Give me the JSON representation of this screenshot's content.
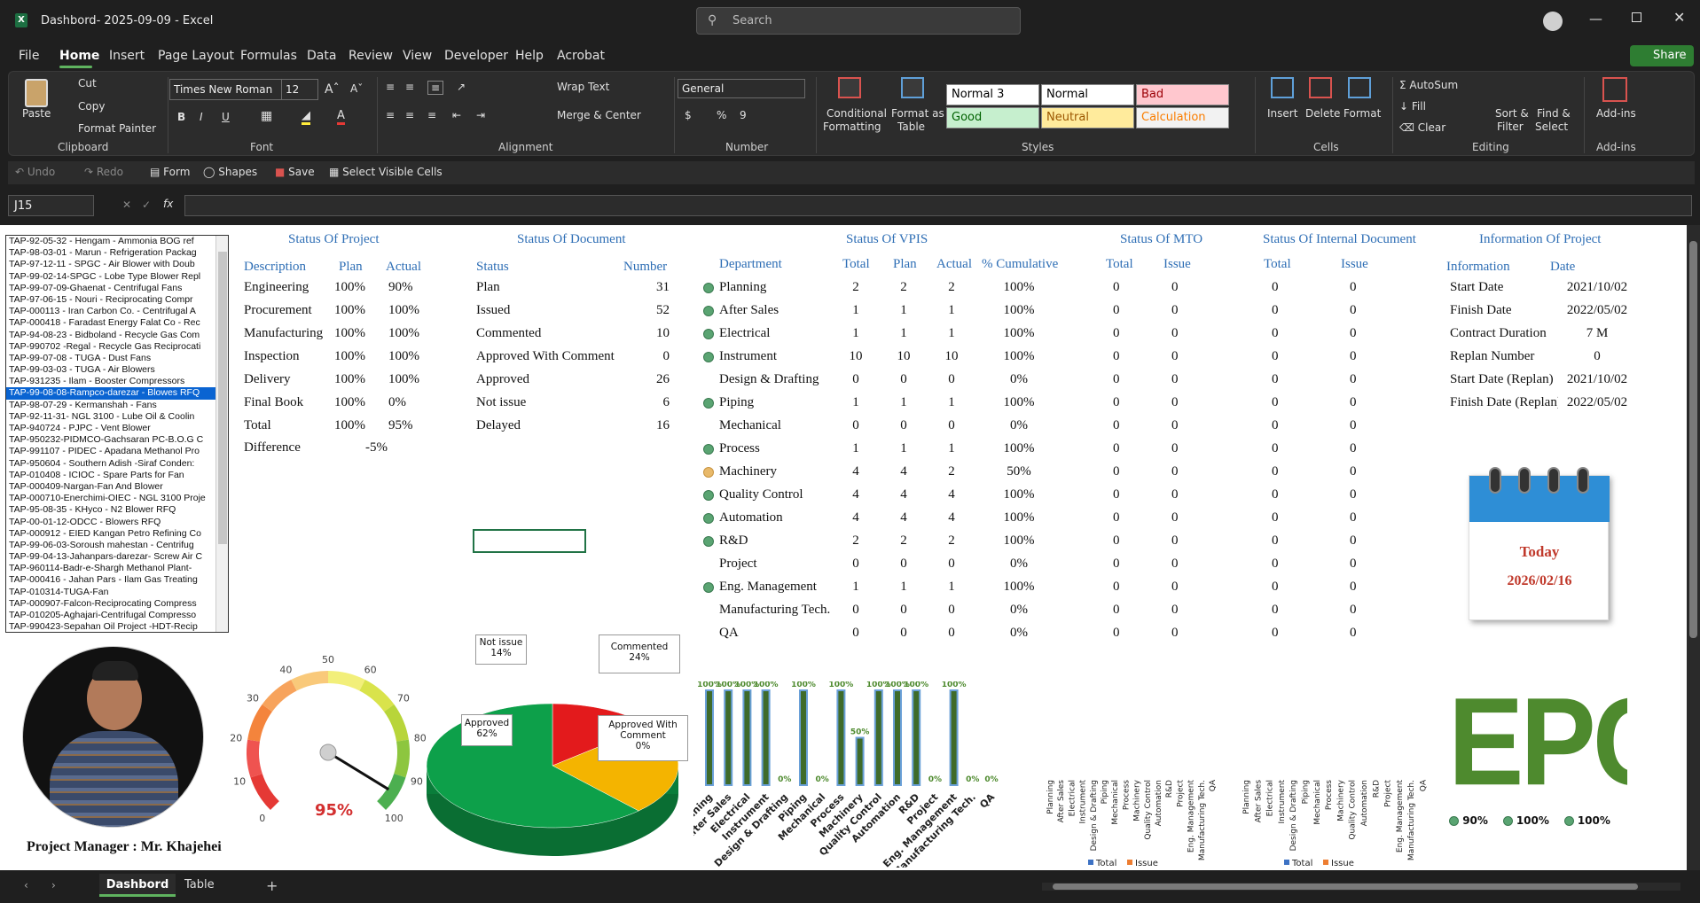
{
  "window": {
    "title": "Dashbord- 2025-09-09  -  Excel",
    "search_placeholder": "Search"
  },
  "menu": {
    "items": [
      "File",
      "Home",
      "Insert",
      "Page Layout",
      "Formulas",
      "Data",
      "Review",
      "View",
      "Developer",
      "Help",
      "Acrobat"
    ],
    "share": "Share"
  },
  "ribbon": {
    "clipboard": {
      "paste": "Paste",
      "cut": "Cut",
      "copy": "Copy",
      "format_painter": "Format Painter",
      "label": "Clipboard"
    },
    "font": {
      "family": "Times New Roman",
      "size": "12",
      "label": "Font"
    },
    "alignment": {
      "wrap": "Wrap Text",
      "merge": "Merge & Center",
      "label": "Alignment"
    },
    "number": {
      "format": "General",
      "label": "Number"
    },
    "styles": {
      "cond_fmt": "Conditional",
      "cond_fmt2": "Formatting",
      "format_table": "Format as",
      "format_table2": "Table",
      "normal3": "Normal 3",
      "normal": "Normal",
      "bad": "Bad",
      "good": "Good",
      "neutral": "Neutral",
      "calculation": "Calculation",
      "label": "Styles"
    },
    "cells": {
      "insert": "Insert",
      "delete": "Delete",
      "format": "Format",
      "label": "Cells"
    },
    "editing": {
      "autosum": "AutoSum",
      "fill": "Fill",
      "clear": "Clear",
      "sort": "Sort &",
      "sort2": "Filter",
      "find": "Find &",
      "find2": "Select",
      "label": "Editing"
    },
    "addins": {
      "label": "Add-ins",
      "btn": "Add-ins"
    }
  },
  "qat": {
    "undo": "Undo",
    "redo": "Redo",
    "form": "Form",
    "shapes": "Shapes",
    "save": "Save",
    "select_visible": "Select Visible Cells"
  },
  "formula_bar": {
    "name_box": "J15",
    "fx": "fx",
    "formula": ""
  },
  "projects": [
    "TAP-92-05-32 - Hengam - Ammonia BOG ref",
    "TAP-98-03-01 - Marun - Refrigeration Packag",
    "TAP-97-12-11 - SPGC - Air Blower with Doub",
    "TAP-99-02-14-SPGC - Lobe Type Blower Repl",
    "TAP-99-07-09-Ghaenat - Centrifugal Fans",
    "TAP-97-06-15 - Nouri - Reciprocating Compr",
    "TAP-000113 - Iran Carbon Co. - Centrifugal A",
    "TAP-000418 - Faradast Energy Falat Co - Rec",
    "TAP-94-08-23 - Bidboland - Recycle Gas Com",
    "TAP-990702 -Regal - Recycle Gas Reciprocati",
    "TAP-99-07-08  - TUGA - Dust Fans",
    "TAP-99-03-03 - TUGA - Air Blowers",
    "TAP-931235 - Ilam - Booster Compressors",
    "TAP-99-08-08-Rampco-darezar - Blowes RFQ",
    "TAP-98-07-29 - Kermanshah - Fans",
    "TAP-92-11-31- NGL 3100 - Lube Oil & Coolin",
    "TAP-940724 - PJPC - Vent Blower",
    "TAP-950232-PIDMCO-Gachsaran PC-B.O.G C",
    "TAP-991107 - PIDEC - Apadana Methanol Pro",
    "TAP-950604 - Southern Adish -Siraf Conden:",
    "TAP-010408 - ICIOC - Spare Parts for Fan",
    "TAP-000409-Nargan-Fan And Blower",
    "TAP-000710-Enerchimi-OIEC - NGL 3100 Proje",
    "TAP-95-08-35 - KHyco - N2 Blower RFQ",
    "TAP-00-01-12-ODCC - Blowers RFQ",
    "TAP-000912 - EIED Kangan Petro Refining Co",
    "TAP-99-06-03-Soroush mahestan - Centrifug",
    "TAP-99-04-13-Jahanpars-darezar- Screw Air C",
    "TAP-960114-Badr-e-Shargh Methanol Plant-",
    "TAP-000416 - Jahan Pars - Ilam Gas Treating",
    "TAP-010314-TUGA-Fan",
    "TAP-000907-Falcon-Reciprocating Compress",
    "TAP-010205-Aghajari-Centrifugal Compresso",
    "TAP-990423-Sepahan Oil Project -HDT-Recip"
  ],
  "status_project": {
    "title": "Status Of Project",
    "headers": [
      "Description",
      "Plan",
      "Actual"
    ],
    "rows": [
      [
        "Engineering",
        "100%",
        "90%"
      ],
      [
        "Procurement",
        "100%",
        "100%"
      ],
      [
        "Manufacturing",
        "100%",
        "100%"
      ],
      [
        "Inspection",
        "100%",
        "100%"
      ],
      [
        "Delivery",
        "100%",
        "100%"
      ],
      [
        "Final Book",
        "100%",
        "0%"
      ],
      [
        "Total",
        "100%",
        "95%"
      ]
    ],
    "difference_label": "Difference",
    "difference": "-5%"
  },
  "status_document": {
    "title": "Status Of Document",
    "headers": [
      "Status",
      "Number"
    ],
    "rows": [
      [
        "Plan",
        "31"
      ],
      [
        "Issued",
        "52"
      ],
      [
        "Commented",
        "10"
      ],
      [
        "Approved With Comment",
        "0"
      ],
      [
        "Approved",
        "26"
      ],
      [
        "Not issue",
        "6"
      ],
      [
        "Delayed",
        "16"
      ]
    ]
  },
  "status_vpis": {
    "title": "Status Of VPIS",
    "headers": [
      "Department",
      "Total",
      "Plan",
      "Actual",
      "% Cumulative"
    ],
    "rows": [
      [
        "Planning",
        "2",
        "2",
        "2",
        "100%",
        "g"
      ],
      [
        "After Sales",
        "1",
        "1",
        "1",
        "100%",
        "g"
      ],
      [
        "Electrical",
        "1",
        "1",
        "1",
        "100%",
        "g"
      ],
      [
        "Instrument",
        "10",
        "10",
        "10",
        "100%",
        "g"
      ],
      [
        "Design & Drafting",
        "0",
        "0",
        "0",
        "0%",
        ""
      ],
      [
        "Piping",
        "1",
        "1",
        "1",
        "100%",
        "g"
      ],
      [
        "Mechanical",
        "0",
        "0",
        "0",
        "0%",
        ""
      ],
      [
        "Process",
        "1",
        "1",
        "1",
        "100%",
        "g"
      ],
      [
        "Machinery",
        "4",
        "4",
        "2",
        "50%",
        "y"
      ],
      [
        "Quality Control",
        "4",
        "4",
        "4",
        "100%",
        "g"
      ],
      [
        "Automation",
        "4",
        "4",
        "4",
        "100%",
        "g"
      ],
      [
        "R&D",
        "2",
        "2",
        "2",
        "100%",
        "g"
      ],
      [
        "Project",
        "0",
        "0",
        "0",
        "0%",
        ""
      ],
      [
        "Eng. Management",
        "1",
        "1",
        "1",
        "100%",
        "g"
      ],
      [
        "Manufacturing Tech.",
        "0",
        "0",
        "0",
        "0%",
        ""
      ],
      [
        "QA",
        "0",
        "0",
        "0",
        "0%",
        ""
      ]
    ]
  },
  "status_mto": {
    "title": "Status Of MTO",
    "headers": [
      "Total",
      "Issue"
    ]
  },
  "status_internal": {
    "title": "Status Of Internal Document",
    "headers": [
      "Total",
      "Issue"
    ]
  },
  "info_project": {
    "title": "Information Of Project",
    "headers": [
      "Information",
      "Date"
    ],
    "rows": [
      [
        "Start Date",
        "2021/10/02"
      ],
      [
        "Finish Date",
        "2022/05/02"
      ],
      [
        "Contract Duration",
        "7 M"
      ],
      [
        "Replan Number",
        "0"
      ],
      [
        "Start Date (Replan)",
        "2021/10/02"
      ],
      [
        "Finish Date (Replan)",
        "2022/05/02"
      ]
    ]
  },
  "calendar": {
    "label": "Today",
    "date": "2026/02/16"
  },
  "manager": {
    "caption": "Project Manager : Mr. Khajehei"
  },
  "gauge": {
    "value": "95%",
    "value_num": 95,
    "ticks": [
      "0",
      "10",
      "20",
      "30",
      "40",
      "50",
      "60",
      "70",
      "80",
      "90",
      "100"
    ]
  },
  "pie": {
    "labels": [
      {
        "name": "Not issue",
        "pct": "14%"
      },
      {
        "name": "Commented",
        "pct": "24%"
      },
      {
        "name": "Approved",
        "pct": "62%"
      },
      {
        "name": "Approved With Comment",
        "pct": "0%"
      }
    ]
  },
  "epc": {
    "text": "EPC",
    "legend": [
      "90%",
      "100%",
      "100%"
    ]
  },
  "chart_data": [
    {
      "type": "bar",
      "title": "",
      "categories": [
        "Planning",
        "After Sales",
        "Electrical",
        "Instrument",
        "Design & Drafting",
        "Piping",
        "Mechanical",
        "Process",
        "Machinery",
        "Quality Control",
        "Automation",
        "R&D",
        "Project",
        "Eng. Management",
        "Manufacturing Tech.",
        "QA"
      ],
      "values": [
        100,
        100,
        100,
        100,
        0,
        100,
        0,
        100,
        50,
        100,
        100,
        100,
        0,
        100,
        0,
        0
      ],
      "labels": [
        "100%",
        "100%",
        "100%",
        "100%",
        "0%",
        "100%",
        "0%",
        "100%",
        "50%",
        "100%",
        "100%",
        "100%",
        "0%",
        "100%",
        "0%",
        "0%"
      ],
      "ylim": [
        0,
        100
      ]
    },
    {
      "type": "bar",
      "categories": [
        "Planning",
        "After Sales",
        "Electrical",
        "Instrument",
        "Design & Drafting",
        "Piping",
        "Mechanical",
        "Process",
        "Machinery",
        "Quality Control",
        "Automation",
        "R&D",
        "Project",
        "Eng. Management",
        "Manufacturing Tech.",
        "QA"
      ],
      "series": [
        {
          "name": "Total",
          "values": [
            0,
            0,
            0,
            0,
            0,
            0,
            0,
            0,
            0,
            0,
            0,
            0,
            0,
            0,
            0,
            0
          ]
        },
        {
          "name": "Issue",
          "values": [
            0,
            0,
            0,
            0,
            0,
            0,
            0,
            0,
            0,
            0,
            0,
            0,
            0,
            0,
            0,
            0
          ]
        }
      ],
      "legend": "bottom"
    },
    {
      "type": "bar",
      "categories": [
        "Planning",
        "After Sales",
        "Electrical",
        "Instrument",
        "Design & Drafting",
        "Piping",
        "Mechanical",
        "Process",
        "Machinery",
        "Quality Control",
        "Automation",
        "R&D",
        "Project",
        "Eng. Management",
        "Manufacturing Tech.",
        "QA"
      ],
      "series": [
        {
          "name": "Total",
          "values": [
            0,
            0,
            0,
            0,
            0,
            0,
            0,
            0,
            0,
            0,
            0,
            0,
            0,
            0,
            0,
            0
          ]
        },
        {
          "name": "Issue",
          "values": [
            0,
            0,
            0,
            0,
            0,
            0,
            0,
            0,
            0,
            0,
            0,
            0,
            0,
            0,
            0,
            0
          ]
        }
      ],
      "legend": "bottom"
    }
  ],
  "sheet_tabs": [
    "Dashbord",
    "Table"
  ]
}
